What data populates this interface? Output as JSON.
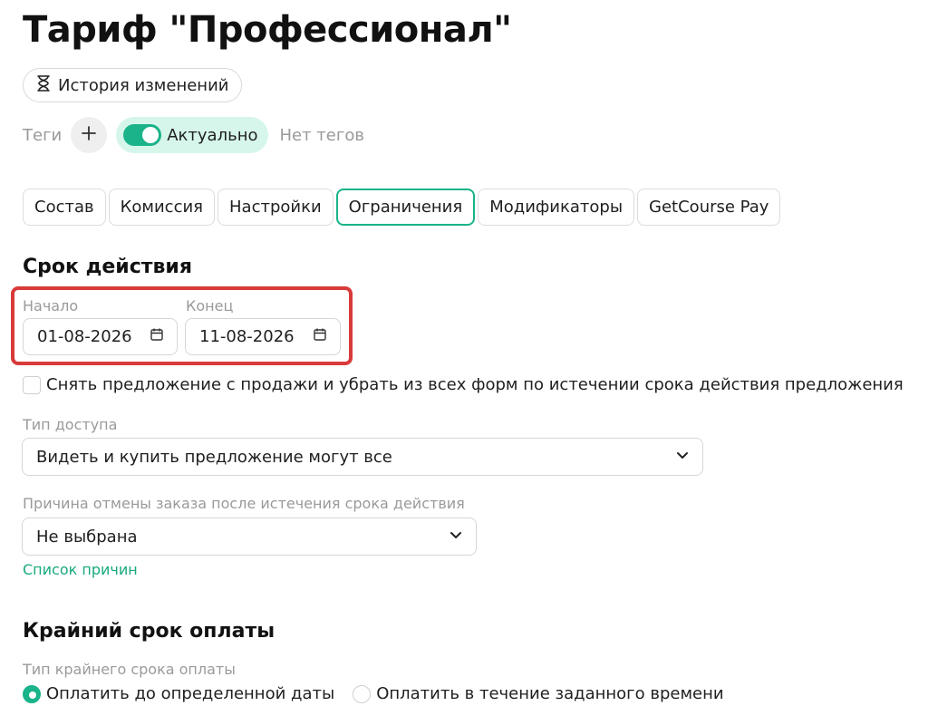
{
  "page": {
    "title": "Тариф \"Профессионал\"",
    "history_button": "История изменений"
  },
  "tags": {
    "label": "Теги",
    "status": "Актуально",
    "status_on": true,
    "empty_text": "Нет тегов"
  },
  "tabs": [
    {
      "label": "Состав",
      "active": false
    },
    {
      "label": "Комиссия",
      "active": false
    },
    {
      "label": "Настройки",
      "active": false
    },
    {
      "label": "Ограничения",
      "active": true
    },
    {
      "label": "Модификаторы",
      "active": false
    },
    {
      "label": "GetCourse Pay",
      "active": false
    }
  ],
  "validity": {
    "title": "Срок действия",
    "start_label": "Начало",
    "start_value": "01-08-2026",
    "end_label": "Конец",
    "end_value": "11-08-2026",
    "remove_offer_label": "Снять предложение с продажи и убрать из всех форм по истечении срока действия предложения",
    "remove_offer_checked": false
  },
  "access": {
    "label": "Тип доступа",
    "value": "Видеть и купить предложение могут все"
  },
  "cancel_reason": {
    "label": "Причина отмены заказа после истечения срока действия",
    "value": "Не выбрана",
    "link": "Список причин"
  },
  "deadline": {
    "title": "Крайний срок оплаты",
    "type_label": "Тип крайнего срока оплаты",
    "options": [
      {
        "label": "Оплатить до определенной даты",
        "checked": true
      },
      {
        "label": "Оплатить в течение заданного времени",
        "checked": false
      }
    ]
  },
  "colors": {
    "accent": "#1ab38a",
    "accent_light": "#d6f6ec",
    "highlight": "#d93a3a",
    "link": "#18a97f",
    "muted": "#9a9a9a"
  }
}
